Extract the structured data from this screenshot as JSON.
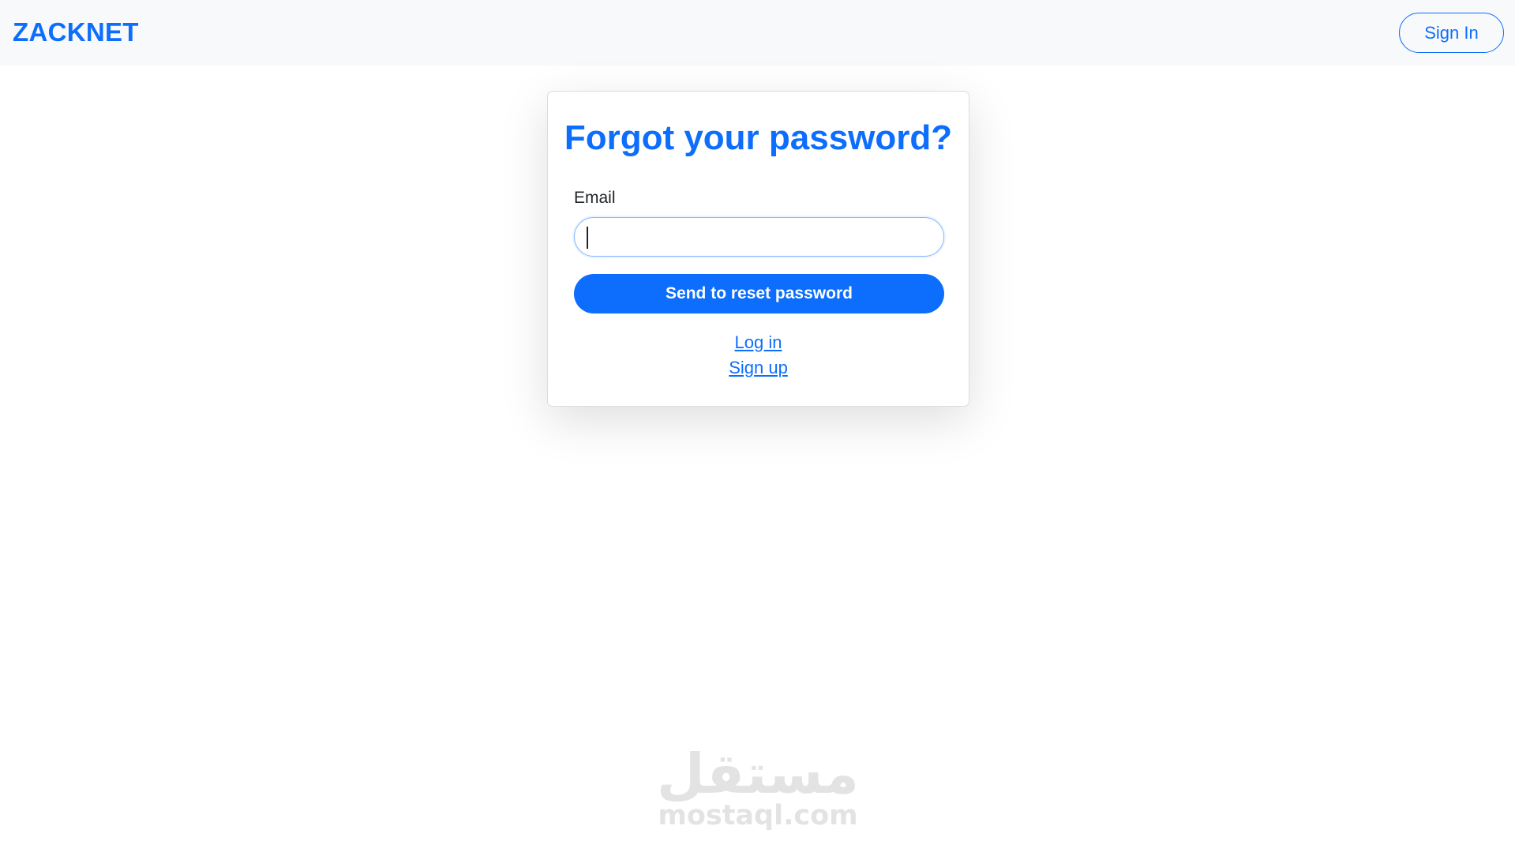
{
  "navbar": {
    "brand": "ZACKNET",
    "signin_label": "Sign In"
  },
  "form": {
    "title": "Forgot your password?",
    "email_label": "Email",
    "email_value": "",
    "submit_label": "Send to reset password",
    "login_link": "Log in",
    "signup_link": "Sign up"
  },
  "watermark": {
    "logo": "مستقل",
    "text": "mostaql.com"
  },
  "colors": {
    "primary": "#0d6efd",
    "navbar_bg": "#f8f9fa",
    "text": "#212529"
  }
}
